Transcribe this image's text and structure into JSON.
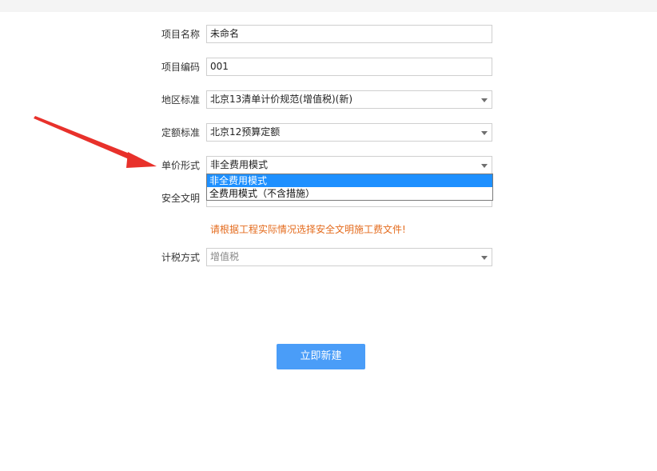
{
  "form": {
    "project_name": {
      "label": "项目名称",
      "value": "未命名"
    },
    "project_code": {
      "label": "项目编码",
      "value": "001"
    },
    "region_standard": {
      "label": "地区标准",
      "value": "北京13清单计价规范(增值税)(新)"
    },
    "quota_standard": {
      "label": "定额标准",
      "value": "北京12预算定额"
    },
    "unit_price_mode": {
      "label": "单价形式",
      "value": "非全费用模式",
      "options": [
        "非全费用模式",
        "全费用模式（不含措施）"
      ],
      "highlighted_option": "非全费用模式"
    },
    "safety_civil": {
      "label": "安全文明",
      "value": ""
    },
    "hint": "请根据工程实际情况选择安全文明施工费文件!",
    "tax_method": {
      "label": "计税方式",
      "value": "增值税"
    },
    "create_button": "立即新建"
  },
  "colors": {
    "accent": "#4a9df8",
    "hint": "#e46b1d",
    "arrow": "#e8312b",
    "highlight": "#1e90ff"
  }
}
